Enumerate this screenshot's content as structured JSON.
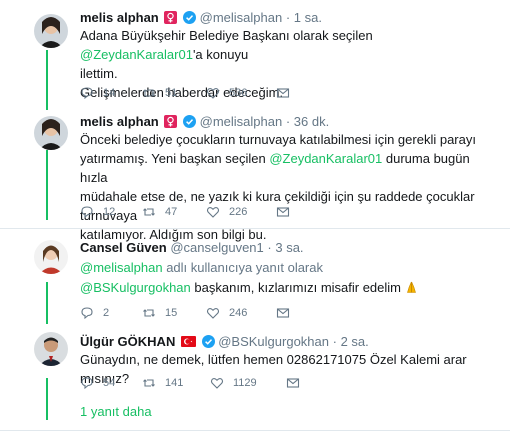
{
  "tweets": [
    {
      "name": "melis alphan",
      "handle": "@melisalphan",
      "time": "1 sa.",
      "text_parts": [
        "Adana Büyükşehir Belediye Başkanı olarak seçilen ",
        "@ZeydanKaralar01",
        "'a konuyu",
        "ilettim.",
        "Gelişmelerden haberdar edeceğim."
      ],
      "replies": "14",
      "retweets": "51",
      "likes": "536"
    },
    {
      "name": "melis alphan",
      "handle": "@melisalphan",
      "time": "36 dk.",
      "text_parts": [
        "Önceki belediye çocukların turnuvaya katılabilmesi için gerekli parayı",
        "yatırmamış. Yeni başkan seçilen ",
        "@ZeydanKaralar01",
        " duruma bugün hızla",
        "müdahale etse de, ne yazık ki kura çekildiği için şu raddede çocuklar turnuvaya",
        "katılamıyor. Aldığım son bilgi bu."
      ],
      "replies": "12",
      "retweets": "47",
      "likes": "226"
    },
    {
      "name": "Cansel Güven",
      "handle": "@canselguven1",
      "time": "3 sa.",
      "reply_to_mention": "@melisalphan",
      "reply_to_suffix": " adlı kullanıcıya yanıt olarak",
      "text_parts": [
        "@BSKulgurgokhan",
        " başkanım, kızlarımızı misafir edelim "
      ],
      "replies": "2",
      "retweets": "15",
      "likes": "246"
    },
    {
      "name": "Ülgür GÖKHAN",
      "handle": "@BSKulgurgokhan",
      "time": "2 sa.",
      "text_parts": [
        "Günaydın, ne demek, lütfen hemen 02862171075 Özel Kalemi arar mısınız?"
      ],
      "replies": "54",
      "retweets": "141",
      "likes": "1129"
    }
  ],
  "more_replies": "1 yanıt daha",
  "dot": "·",
  "colors": {
    "accent": "#17bf63",
    "muted": "#657786",
    "verified": "#1da1f2",
    "divider": "#e1e8ed"
  }
}
